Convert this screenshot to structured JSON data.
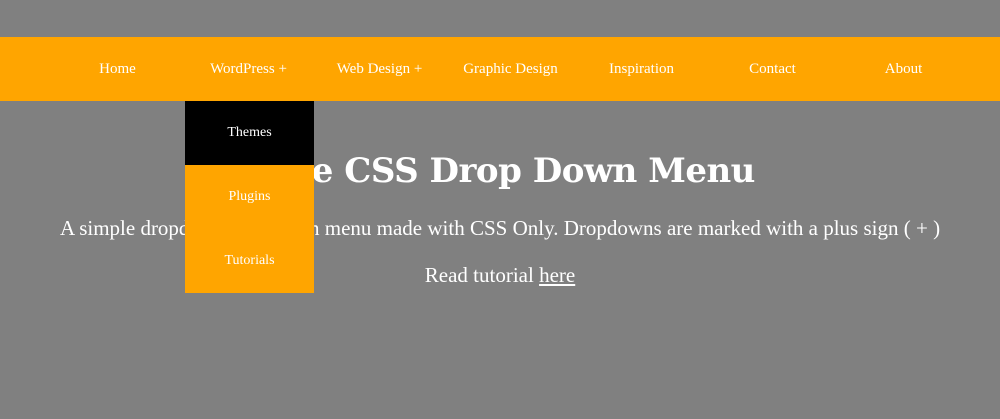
{
  "colors": {
    "background": "#808080",
    "nav_bg": "#ffa500",
    "dropdown_hover": "#000000",
    "text": "#ffffff"
  },
  "nav": {
    "items": [
      {
        "label": "Home"
      },
      {
        "label": "WordPress +"
      },
      {
        "label": "Web Design +"
      },
      {
        "label": "Graphic Design"
      },
      {
        "label": "Inspiration"
      },
      {
        "label": "Contact"
      },
      {
        "label": "About"
      }
    ]
  },
  "dropdown": {
    "parent": "WordPress +",
    "items": [
      {
        "label": "Themes",
        "active": true
      },
      {
        "label": "Plugins",
        "active": false
      },
      {
        "label": "Tutorials",
        "active": false
      }
    ]
  },
  "main": {
    "title": "Pure CSS Drop Down Menu",
    "subtitle": "A simple dropdown navigation menu made with CSS Only. Dropdowns are marked with a plus sign ( + )",
    "tutorial_prefix": "Read tutorial ",
    "tutorial_link": "here"
  }
}
